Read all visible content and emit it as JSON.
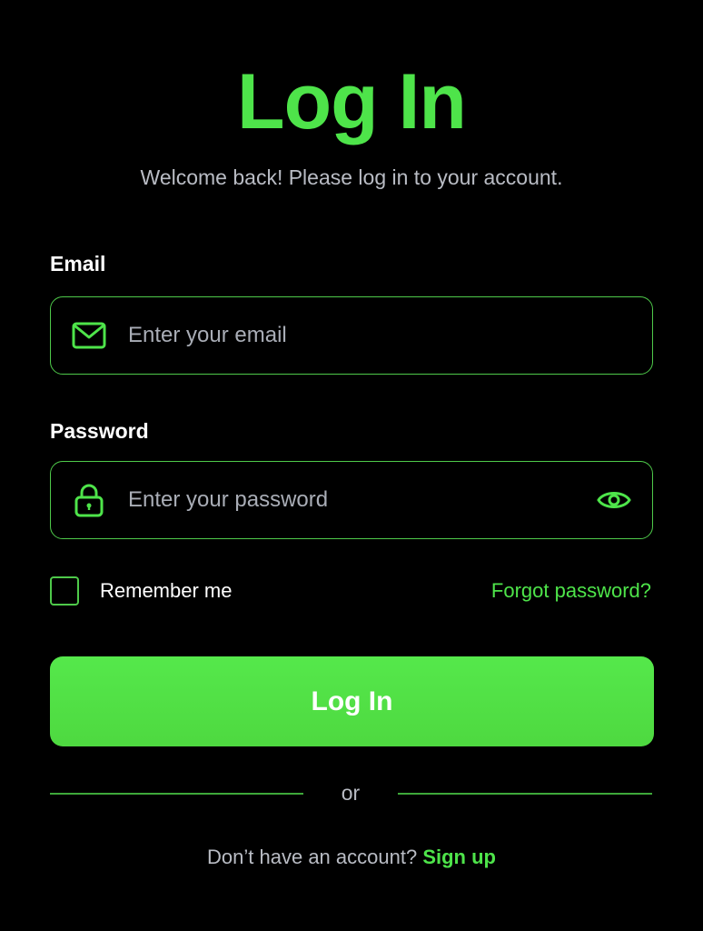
{
  "header": {
    "title": "Log In",
    "subtitle": "Welcome back! Please log in to your account."
  },
  "form": {
    "email": {
      "label": "Email",
      "value": "",
      "placeholder": "Enter your email",
      "icon": "mail-icon"
    },
    "password": {
      "label": "Password",
      "value": "",
      "placeholder": "Enter your password",
      "icon": "lock-icon",
      "toggle_icon": "eye-icon"
    },
    "remember": {
      "label": "Remember me",
      "checked": false
    },
    "forgot_label": "Forgot password?",
    "submit_label": "Log In"
  },
  "divider": {
    "text": "or"
  },
  "footer": {
    "prompt": "Don’t have an account?",
    "link_label": "Sign up"
  },
  "colors": {
    "background": "#000000",
    "accent": "#4ee44a",
    "border": "#4ec94a",
    "muted_text": "#b9bcc4",
    "text": "#ffffff"
  }
}
